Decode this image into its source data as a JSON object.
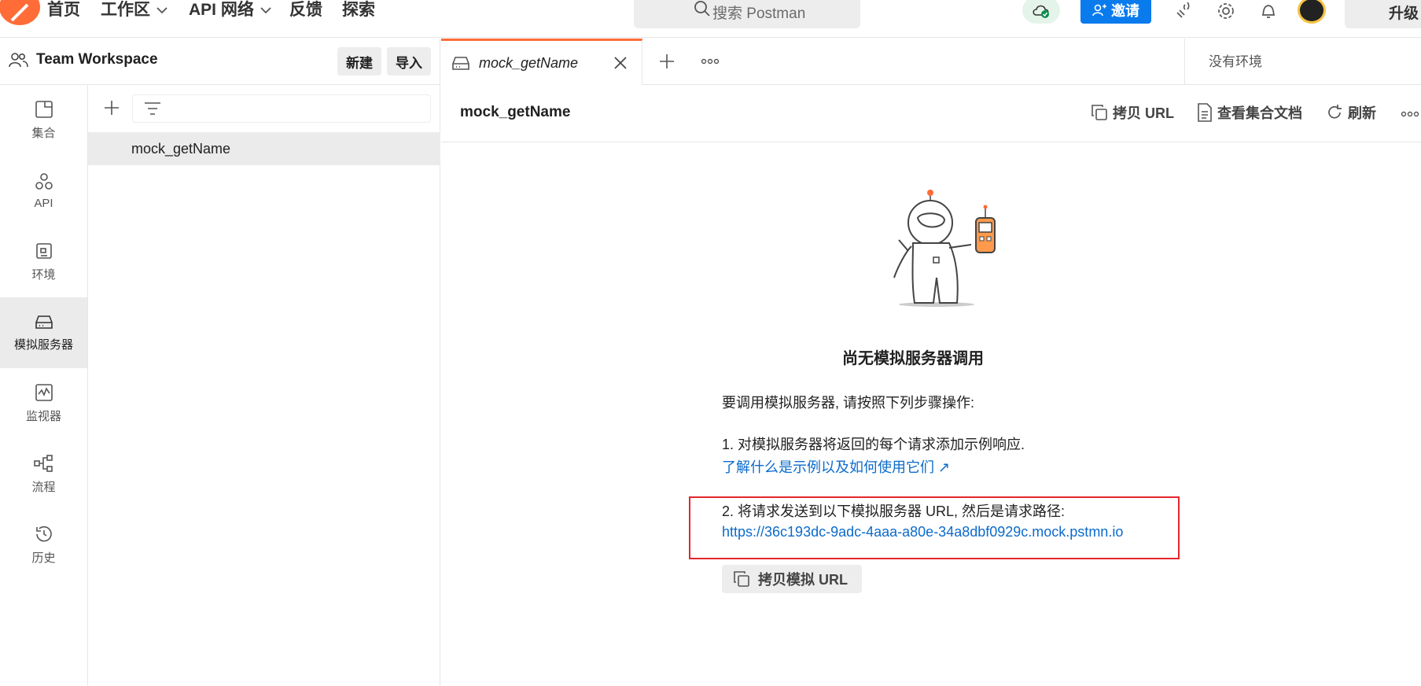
{
  "nav": {
    "home": "首页",
    "workspaces": "工作区",
    "api_network": "API 网络",
    "feedback": "反馈",
    "explore": "探索"
  },
  "search": {
    "placeholder": "搜索 Postman"
  },
  "header_actions": {
    "invite": "邀请",
    "upgrade": "升级"
  },
  "workspace": {
    "name": "Team Workspace",
    "new_label": "新建",
    "import_label": "导入"
  },
  "sidebar": {
    "items": [
      {
        "label": "集合",
        "icon": "collections-icon"
      },
      {
        "label": "API",
        "icon": "apis-icon"
      },
      {
        "label": "环境",
        "icon": "environments-icon"
      },
      {
        "label": "模拟服务器",
        "icon": "mock-servers-icon"
      },
      {
        "label": "监视器",
        "icon": "monitors-icon"
      },
      {
        "label": "流程",
        "icon": "flows-icon"
      },
      {
        "label": "历史",
        "icon": "history-icon"
      }
    ]
  },
  "mock_list": {
    "items": [
      "mock_getName"
    ]
  },
  "tabs": {
    "active_label": "mock_getName",
    "environment": "没有环境"
  },
  "content": {
    "title": "mock_getName",
    "copy_url": "拷贝 URL",
    "view_docs": "查看集合文档",
    "refresh": "刷新",
    "empty_title": "尚无模拟服务器调用",
    "intro": "要调用模拟服务器, 请按照下列步骤操作:",
    "step1": "1. 对模拟服务器将返回的每个请求添加示例响应.",
    "learn_link": "了解什么是示例以及如何使用它们 ↗",
    "step2": "2. 将请求发送到以下模拟服务器 URL, 然后是请求路径:",
    "mock_url": "https://36c193dc-9adc-4aaa-a80e-34a8dbf0929c.mock.pstmn.io",
    "copy_mock_url": "拷贝模拟 URL"
  },
  "colors": {
    "accent": "#ff6c37",
    "primary": "#097bed",
    "link": "#0b6bcb",
    "highlight": "#e4262d"
  }
}
